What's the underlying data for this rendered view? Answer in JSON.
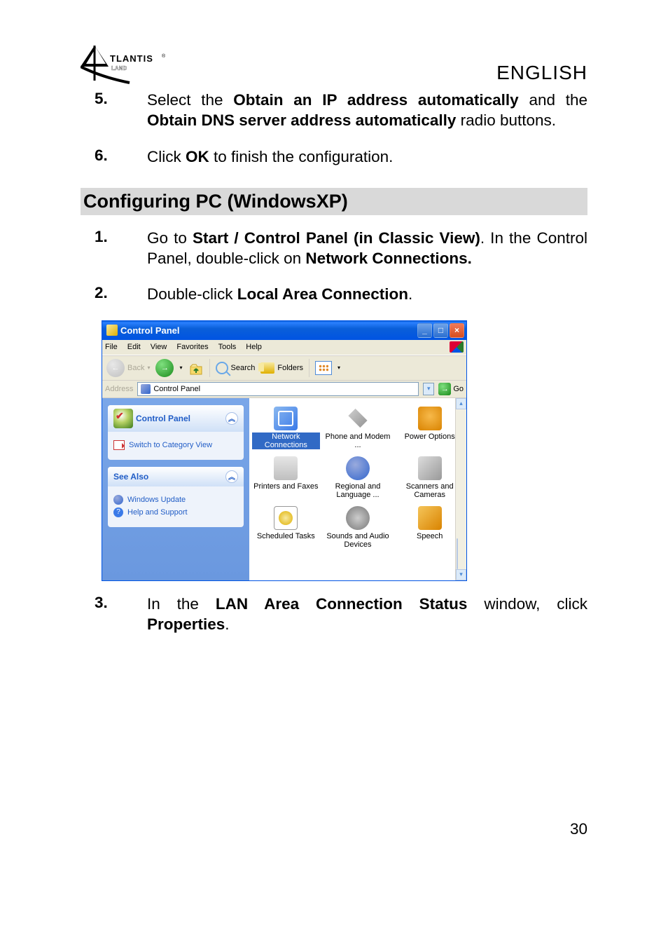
{
  "header": {
    "language": "ENGLISH",
    "logo_text": "ATLANTIS",
    "logo_sub": "LAND"
  },
  "steps_top": [
    {
      "num": "5.",
      "pre": "Select the ",
      "b1": "Obtain an IP address automatically",
      "mid": " and the ",
      "b2": "Obtain DNS server address automatically",
      "post": " radio buttons."
    },
    {
      "num": "6.",
      "pre": "Click ",
      "b1": "OK",
      "post": " to finish the configuration."
    }
  ],
  "section_heading": "Configuring   PC (WindowsXP)",
  "steps_mid": [
    {
      "num": "1.",
      "pre": "Go to ",
      "b1": "Start / Control Panel (in Classic View)",
      "mid": ". In the Control Panel, double-click on ",
      "b2": "Network Connections."
    },
    {
      "num": "2.",
      "pre": "Double-click ",
      "b1": "Local Area Connection",
      "post": "."
    }
  ],
  "steps_bottom": [
    {
      "num": "3.",
      "pre": "In the ",
      "b1": "LAN Area Connection Status",
      "mid": " window, click ",
      "b2": "Properties",
      "post": "."
    }
  ],
  "page_number": "30",
  "xp": {
    "title": "Control Panel",
    "menu": [
      "File",
      "Edit",
      "View",
      "Favorites",
      "Tools",
      "Help"
    ],
    "toolbar": {
      "back": "Back",
      "search": "Search",
      "folders": "Folders"
    },
    "address": {
      "label": "Address",
      "value": "Control Panel",
      "go": "Go"
    },
    "side_panel1": {
      "title": "Control Panel",
      "task": "Switch to Category View"
    },
    "side_panel2": {
      "title": "See Also",
      "task1": "Windows Update",
      "task2": "Help and Support"
    },
    "icons": [
      {
        "key": "net",
        "label": "Network Connections",
        "selected": true
      },
      {
        "key": "phone",
        "label": "Phone and Modem ..."
      },
      {
        "key": "power",
        "label": "Power Options"
      },
      {
        "key": "printer",
        "label": "Printers and Faxes"
      },
      {
        "key": "region",
        "label": "Regional and Language ..."
      },
      {
        "key": "scan",
        "label": "Scanners and Cameras"
      },
      {
        "key": "sched",
        "label": "Scheduled Tasks"
      },
      {
        "key": "sound",
        "label": "Sounds and Audio Devices"
      },
      {
        "key": "speech",
        "label": "Speech"
      }
    ]
  }
}
